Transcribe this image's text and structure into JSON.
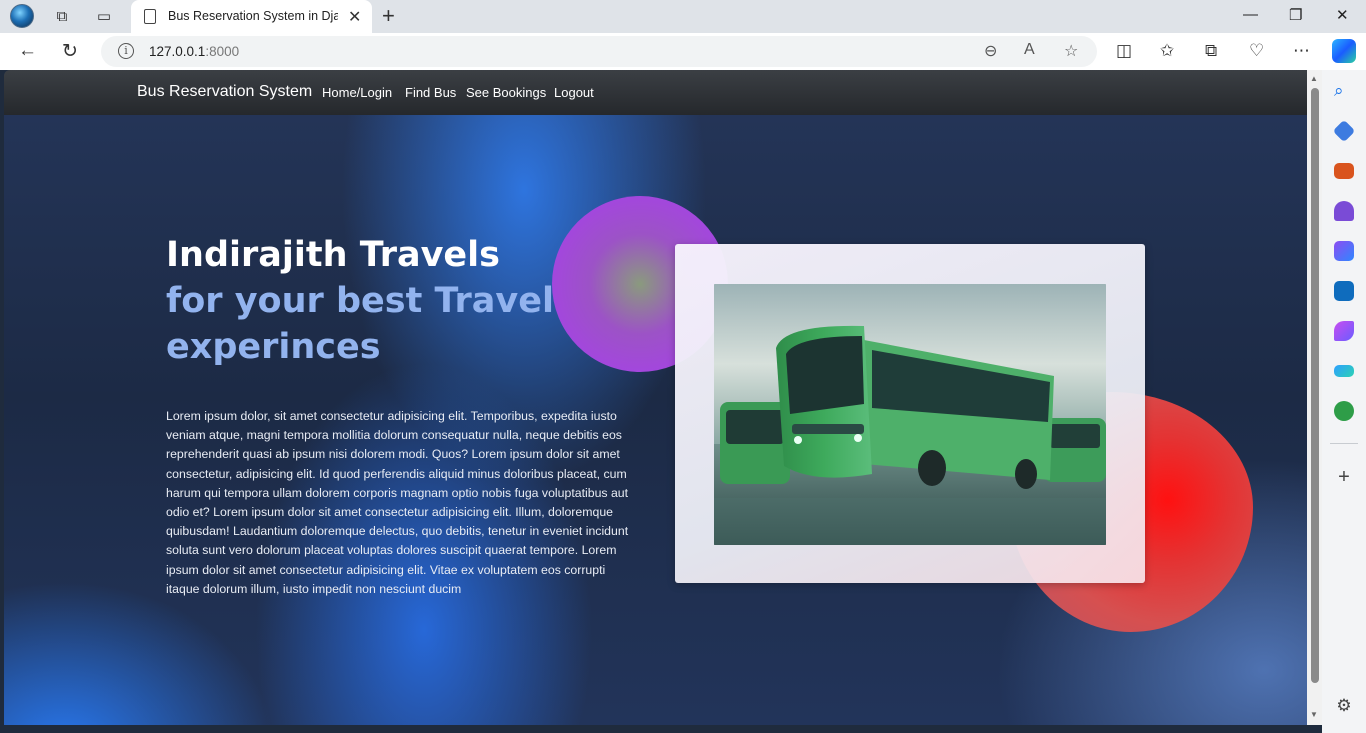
{
  "browser": {
    "tab_title": "Bus Reservation System in Django",
    "url_host": "127.0.0.1",
    "url_port": ":8000"
  },
  "site": {
    "brand": "Bus Reservation System",
    "nav": [
      "Home/Login",
      "Find Bus",
      "See Bookings",
      "Logout"
    ]
  },
  "hero": {
    "title": "Indirajith Travels",
    "subtitle": "for your best Travel experinces",
    "body": "Lorem ipsum dolor, sit amet consectetur adipisicing elit. Temporibus, expedita iusto veniam atque, magni tempora mollitia dolorum consequatur nulla, neque debitis eos reprehenderit quasi ab ipsum nisi dolorem modi. Quos? Lorem ipsum dolor sit amet consectetur, adipisicing elit. Id quod perferendis aliquid minus doloribus placeat, cum harum qui tempora ullam dolorem corporis magnam optio nobis fuga voluptatibus aut odio et? Lorem ipsum dolor sit amet consectetur adipisicing elit. Illum, doloremque quibusdam! Laudantium doloremque delectus, quo debitis, tenetur in eveniet incidunt soluta sunt vero dolorum placeat voluptas dolores suscipit quaerat tempore. Lorem ipsum dolor sit amet consectetur adipisicing elit. Vitae ex voluptatem eos corrupti itaque dolorum illum, iusto impedit non nesciunt ducim"
  },
  "colors": {
    "navbar": "#2a2d31",
    "hero_subtitle": "#92b3ee",
    "purple_blob": "#a445e0",
    "red_blob": "#ff1111"
  },
  "icons": {
    "sidebar": [
      "search-icon",
      "tag-icon",
      "toolbox-icon",
      "chess-icon",
      "office-icon",
      "outlook-icon",
      "designer-icon",
      "send-icon",
      "tree-icon",
      "add-icon",
      "settings-icon"
    ]
  }
}
